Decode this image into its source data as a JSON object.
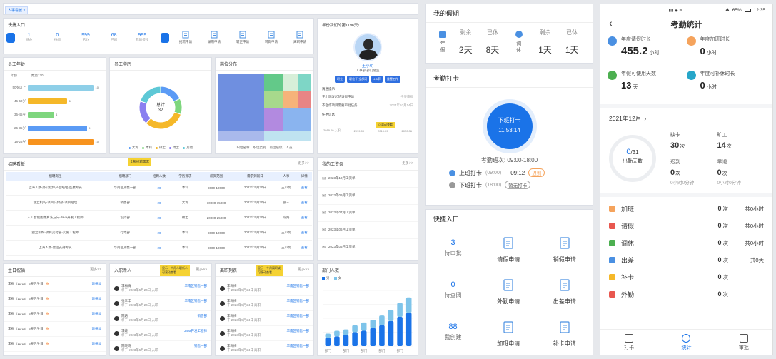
{
  "dashboard": {
    "tab": "人事看板",
    "quick": {
      "title": "快捷入口",
      "stats": [
        {
          "num": "1",
          "label": "待办"
        },
        {
          "num": "0",
          "label": "待阅"
        },
        {
          "num": "999",
          "label": "已办"
        },
        {
          "num": "68",
          "label": "已阅"
        },
        {
          "num": "999",
          "label": "我的授权"
        }
      ],
      "buttons": [
        "招聘申请",
        "录用申请",
        "转正申请",
        "转岗申请",
        "离职申请"
      ]
    },
    "profile": {
      "greeting": "年份我们的第1198天!",
      "name": "王小明",
      "dept": "人事部 部门总监",
      "tags": [
        "职业",
        "职位于 全部研",
        "4.5率",
        "重置工作"
      ],
      "todo_title": "消息提示",
      "todos": [
        {
          "t": "王小明发起的请假申请",
          "d": "今天审批"
        },
        {
          "t": "不合作项目需要审批任务",
          "d": "2024年10月14日"
        }
      ],
      "tasks_title": "任务信息",
      "tl": [
        "2019.09 入职",
        "2019.09",
        "2019.09",
        "2020.06"
      ]
    },
    "age": {
      "title": "员工年龄",
      "header_a": "年龄",
      "header_b": "数量: 20",
      "rows": [
        {
          "label": "50岁以上",
          "v": 10,
          "c": "#8ecfe8"
        },
        {
          "label": "45-50岁",
          "v": 6,
          "c": "#f5b829"
        },
        {
          "label": "35-45岁",
          "v": 4,
          "c": "#7ed67e"
        },
        {
          "label": "25-35岁",
          "v": 9,
          "c": "#5b9bf5"
        },
        {
          "label": "18-25岁",
          "v": 10,
          "c": "#f7931e"
        }
      ]
    },
    "edu": {
      "title": "员工学历",
      "center_label": "总计",
      "center_value": "32",
      "legend": [
        "大专",
        "本科",
        "硕士",
        "博士",
        "其他"
      ],
      "colors": [
        "#5b9bf5",
        "#7ed67e",
        "#f5b829",
        "#8a7ff0",
        "#5ec8d6"
      ]
    },
    "pos": {
      "title": "岗位分布",
      "legend": [
        "职位名称",
        "职位类别",
        "岗位层级",
        "人员"
      ]
    },
    "recruit": {
      "title": "招聘看板",
      "more": "更多>>",
      "badge": "全部招聘需求",
      "cols": [
        "招聘岗位",
        "招聘部门",
        "招聘人数",
        "学历要求",
        "薪资范围",
        "需求到岗日",
        "人事",
        "详情"
      ],
      "rows": [
        [
          "上海人数-办公软件产品经理-医费专员",
          "华南区销售一部",
          "20",
          "本科",
          "8000-10000",
          "2023年5月30日",
          "王小明",
          "查看"
        ],
        [
          "独立机构-项目交付部-项目经理",
          "销售部",
          "20",
          "大专",
          "10000-15000",
          "2023年5月30日",
          "张三",
          "查看"
        ],
        [
          "人工智能图像算法方向-Java开发工程师",
          "设计部",
          "20",
          "硕士",
          "20000-25000",
          "2023年5月30日",
          "陈路",
          "查看"
        ],
        [
          "独立机构-项目交付部-实施工程师",
          "行政部",
          "20",
          "本科",
          "8000-10000",
          "2023年5月30日",
          "王小明",
          "查看"
        ],
        [
          "上海人数-营运支持专员",
          "华南区销售一部",
          "20",
          "本科",
          "8000-10000",
          "2023年5月30日",
          "王小明",
          "查看"
        ]
      ]
    },
    "salary": {
      "title": "我的工资条",
      "more": "更多>>",
      "items": [
        "2023年10月工资单",
        "2023年09月工资单",
        "2023年07月工资单",
        "2023年06月工资单",
        "2023年05月工资单"
      ]
    },
    "birthday": {
      "title": "生日祝福",
      "more": "更多>>",
      "items": [
        "李梅（11-13）6天后生日",
        "李梅（11-13）6天后生日",
        "李梅（11-13）6天后生日",
        "李梅（11-13）6天后生日",
        "李梅（11-13）6天后生日"
      ],
      "action": "送祝福"
    },
    "newhire": {
      "title": "入职新人",
      "more": "更多>>",
      "tip": "显示一个月人职新人\n可滚动查看",
      "items": [
        {
          "n": "李梅梅",
          "d": "将于 2023年5月24日 入职",
          "r": "华南区销售一部"
        },
        {
          "n": "张三丰",
          "d": "将于 2023年5月24日 入职",
          "r": "华南区销售一部"
        },
        {
          "n": "陈路",
          "d": "将于 2023年5月24日 入职",
          "r": "销售部"
        },
        {
          "n": "李婕",
          "d": "将于 2023年5月24日 入职",
          "r": "Java开发工程师"
        },
        {
          "n": "陈晓晓",
          "d": "将于 2023年5月24日 入职",
          "r": "销售一部"
        }
      ]
    },
    "leave": {
      "title": "离职列表",
      "more": "更多>>",
      "tip": "显示一个月离职或\n可滚动查看",
      "items": [
        {
          "n": "李梅梅",
          "d": "于 2023年5月24日 离职",
          "r": "华南区销售一部"
        },
        {
          "n": "李梅梅",
          "d": "于 2023年5月24日 离职",
          "r": "华南区销售一部"
        },
        {
          "n": "李梅梅",
          "d": "于 2023年5月24日 离职",
          "r": "华南区销售一部"
        },
        {
          "n": "李梅梅",
          "d": "于 2023年5月24日 离职",
          "r": "华南区销售一部"
        },
        {
          "n": "李梅梅",
          "d": "于 2023年5月24日 离职",
          "r": "华南区销售一部"
        }
      ]
    },
    "dept": {
      "title": "部门人数",
      "legend": [
        "男",
        "女"
      ],
      "tick": "部门"
    }
  },
  "chart_data": {
    "type": "bar",
    "title": "部门人数",
    "series": [
      {
        "name": "男",
        "values": [
          12,
          14,
          16,
          20,
          22,
          26,
          30,
          36,
          42,
          48
        ]
      },
      {
        "name": "女",
        "values": [
          6,
          8,
          8,
          10,
          12,
          12,
          14,
          16,
          20,
          22
        ]
      }
    ],
    "categories": [
      "部门",
      "部门",
      "部门",
      "部门",
      "部门",
      "部门",
      "部门",
      "部门",
      "部门",
      "部门"
    ]
  },
  "middle": {
    "vacation": {
      "title": "我的假期",
      "a_label": "年假",
      "b_label": "调休",
      "remain": "剩余",
      "rest": "已休",
      "a_remain": "2天",
      "a_rest": "8天",
      "b_remain": "1天",
      "b_rest": "1天"
    },
    "clock": {
      "title": "考勤打卡",
      "btn": "下班打卡",
      "time": "11:53:14",
      "shift_label": "考勤班次:",
      "shift": "09:00-18:00",
      "on_label": "上班打卡",
      "on_plan": "(09:00)",
      "on_actual": "09:12",
      "on_tag": "迟到",
      "off_label": "下班打卡",
      "off_plan": "(18:00)",
      "off_tag": "暂无打卡"
    },
    "quick": {
      "title": "快捷入口",
      "stats": [
        {
          "num": "3",
          "label": "待审批"
        },
        {
          "num": "0",
          "label": "待查阅"
        },
        {
          "num": "88",
          "label": "我创建"
        }
      ],
      "btns": [
        "请假申请",
        "销假申请",
        "外勤申请",
        "出差申请",
        "加班申请",
        "补卡申请"
      ]
    }
  },
  "phone": {
    "status_time": "12:35",
    "battery": "65%",
    "title": "考勤统计",
    "stats": [
      {
        "label": "年度请假时长",
        "val": "455.2",
        "unit": "小时",
        "c": "#4a90e2"
      },
      {
        "label": "年度加班时长",
        "val": "0",
        "unit": "小时",
        "c": "#f5a35c"
      },
      {
        "label": "年假可使用天数",
        "val": "13",
        "unit": "天",
        "c": "#4caf50"
      },
      {
        "label": "年度可补休时长",
        "val": "0",
        "unit": "小时",
        "c": "#26a6c9"
      }
    ],
    "month": "2021年12月",
    "ring_num": "0",
    "ring_den": "/31",
    "ring_label": "出勤天数",
    "m": [
      {
        "l": "缺卡",
        "v": "30",
        "u": "次",
        "s": ""
      },
      {
        "l": "旷工",
        "v": "14",
        "u": "次",
        "s": ""
      },
      {
        "l": "迟到",
        "v": "0",
        "u": "次",
        "s": "0小时0分钟"
      },
      {
        "l": "早退",
        "v": "0",
        "u": "次",
        "s": "0小时0分钟"
      }
    ],
    "rows": [
      {
        "n": "加班",
        "c": "0",
        "u": "次",
        "h": "共0小时",
        "col": "#f5a35c"
      },
      {
        "n": "请假",
        "c": "0",
        "u": "次",
        "h": "共0小时",
        "col": "#e8574f"
      },
      {
        "n": "调休",
        "c": "0",
        "u": "次",
        "h": "共0小时",
        "col": "#4caf50"
      },
      {
        "n": "出差",
        "c": "0",
        "u": "次",
        "h": "共0天",
        "col": "#4a90e2"
      },
      {
        "n": "补卡",
        "c": "0",
        "u": "次",
        "h": "",
        "col": "#f5b829"
      },
      {
        "n": "外勤",
        "c": "0",
        "u": "次",
        "h": "",
        "col": "#e8574f"
      }
    ],
    "nav": [
      "打卡",
      "统计",
      "审批"
    ]
  }
}
